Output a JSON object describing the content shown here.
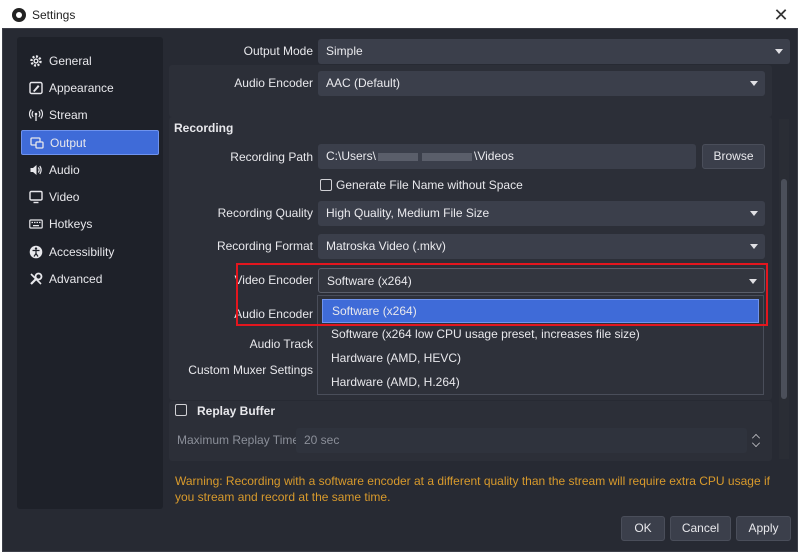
{
  "window": {
    "title": "Settings",
    "close_glyph": "✕"
  },
  "sidebar": {
    "items": [
      {
        "label": "General",
        "icon": "gear-icon"
      },
      {
        "label": "Appearance",
        "icon": "appearance-icon"
      },
      {
        "label": "Stream",
        "icon": "stream-icon"
      },
      {
        "label": "Output",
        "icon": "output-icon",
        "active": true
      },
      {
        "label": "Audio",
        "icon": "speaker-icon"
      },
      {
        "label": "Video",
        "icon": "monitor-icon"
      },
      {
        "label": "Hotkeys",
        "icon": "keyboard-icon"
      },
      {
        "label": "Accessibility",
        "icon": "accessibility-icon"
      },
      {
        "label": "Advanced",
        "icon": "wrench-icon"
      }
    ]
  },
  "streaming": {
    "output_mode_label": "Output Mode",
    "output_mode_value": "Simple",
    "audio_encoder_label": "Audio Encoder",
    "audio_encoder_value": "AAC (Default)"
  },
  "recording": {
    "title": "Recording",
    "path_label": "Recording Path",
    "path_value_prefix": "C:\\Users\\",
    "path_value_suffix": "\\Videos",
    "browse_label": "Browse",
    "generate_filename_label": "Generate File Name without Space",
    "quality_label": "Recording Quality",
    "quality_value": "High Quality, Medium File Size",
    "format_label": "Recording Format",
    "format_value": "Matroska Video (.mkv)",
    "video_encoder_label": "Video Encoder",
    "video_encoder_value": "Software (x264)",
    "audio_encoder_label": "Audio Encoder",
    "audio_track_label": "Audio Track",
    "custom_muxer_label": "Custom Muxer Settings"
  },
  "video_encoder_options": [
    "Software (x264)",
    "Software (x264 low CPU usage preset, increases file size)",
    "Hardware (AMD, HEVC)",
    "Hardware (AMD, H.264)"
  ],
  "replay_buffer": {
    "title": "Replay Buffer",
    "max_time_label": "Maximum Replay Time",
    "max_time_value": "20 sec"
  },
  "warning": "Warning: Recording with a software encoder at a different quality than the stream will require extra CPU usage if you stream and record at the same time.",
  "buttons": {
    "ok": "OK",
    "cancel": "Cancel",
    "apply": "Apply"
  },
  "colors": {
    "accent": "#3f6bd8",
    "highlight": "#e3161e",
    "warning": "#d89a2c",
    "background": "#272a33"
  }
}
